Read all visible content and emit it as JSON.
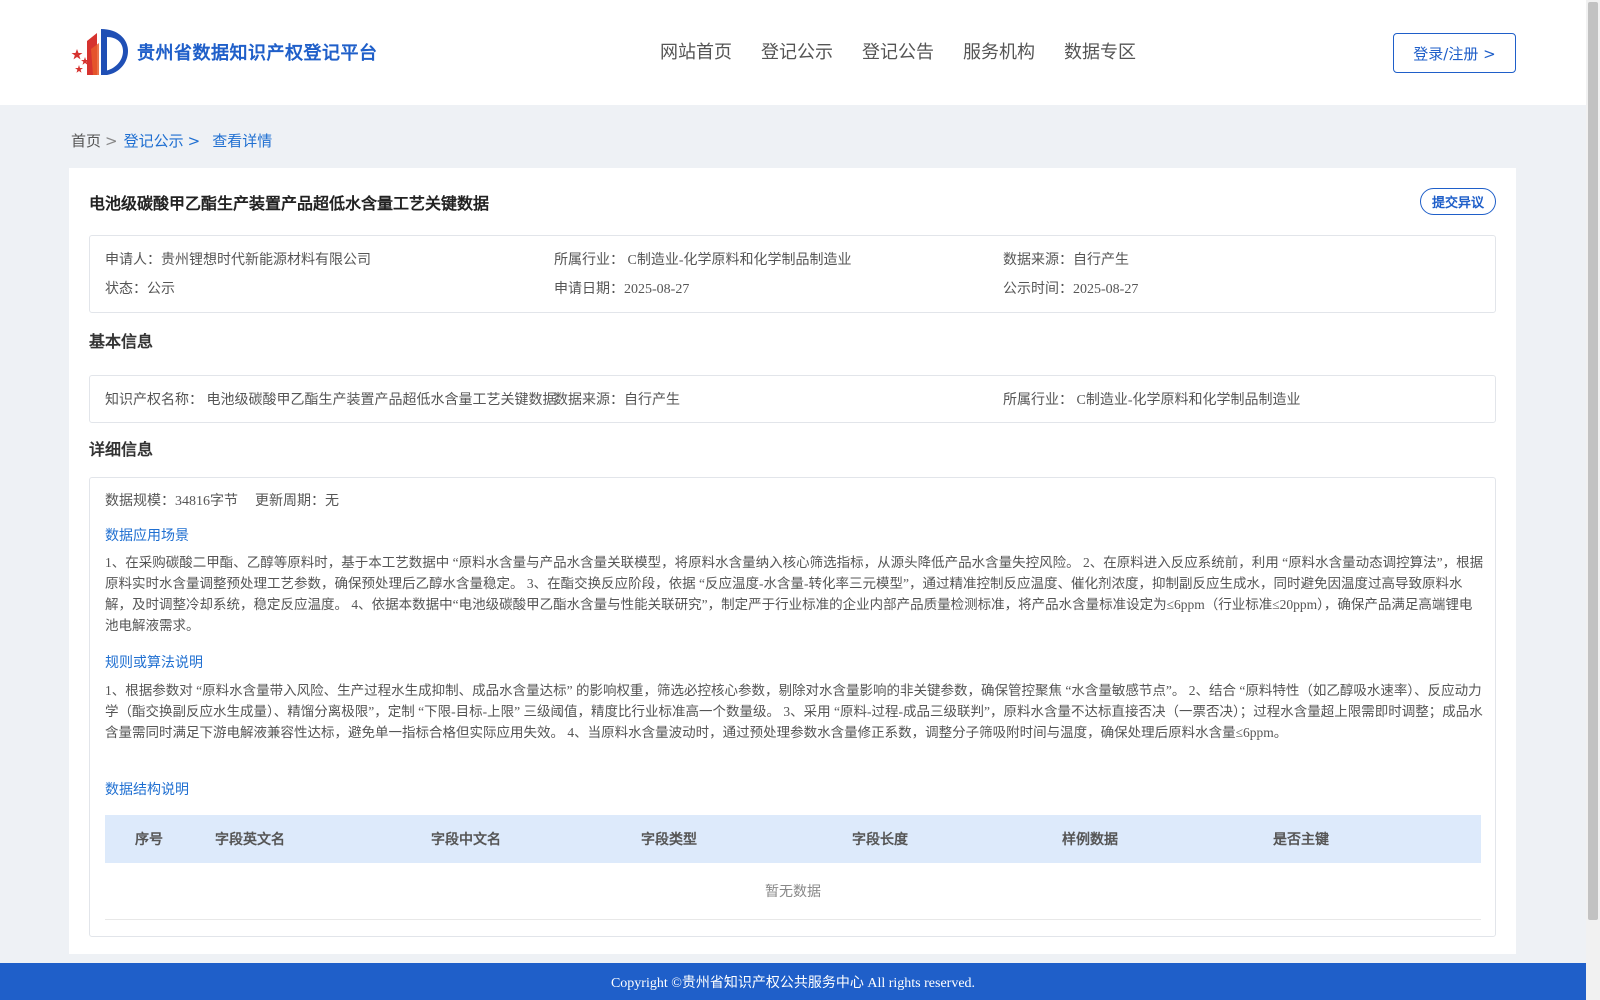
{
  "header": {
    "logo_text": "贵州省数据知识产权登记平台",
    "nav": [
      "网站首页",
      "登记公示",
      "登记公告",
      "服务机构",
      "数据专区"
    ],
    "login_label": "登录/注册 >"
  },
  "breadcrumb": {
    "home": "首页",
    "sep": ">",
    "level1": "登记公示",
    "current": "查看详情"
  },
  "record": {
    "title": "电池级碳酸甲乙酯生产装置产品超低水含量工艺关键数据",
    "objection_label": "提交异议",
    "summary": {
      "applicant": "申请人：贵州锂想时代新能源材料有限公司",
      "industry": "所属行业： C制造业-化学原料和化学制品制造业",
      "source": "数据来源：自行产生",
      "status": "状态：公示",
      "apply_date": "申请日期：2025-08-27",
      "publish_date": "公示时间：2025-08-27"
    }
  },
  "basic": {
    "heading": "基本信息",
    "ip_name": "知识产权名称： 电池级碳酸甲乙酯生产装置产品超低水含量工艺关键数据",
    "source": "数据来源：自行产生",
    "industry": "所属行业： C制造业-化学原料和化学制品制造业"
  },
  "detail": {
    "heading": "详细信息",
    "scale": "数据规模：34816字节",
    "cycle": "更新周期：无",
    "scenario_title": "数据应用场景",
    "scenario_text": "1、在采购碳酸二甲酯、乙醇等原料时，基于本工艺数据中 “原料水含量与产品水含量关联模型，将原料水含量纳入核心筛选指标，从源头降低产品水含量失控风险。 2、在原料进入反应系统前，利用 “原料水含量动态调控算法”，根据原料实时水含量调整预处理工艺参数，确保预处理后乙醇水含量稳定。 3、在酯交换反应阶段，依据 “反应温度-水含量-转化率三元模型”，通过精准控制反应温度、催化剂浓度，抑制副反应生成水，同时避免因温度过高导致原料水解，及时调整冷却系统，稳定反应温度。 4、依据本数据中“电池级碳酸甲乙酯水含量与性能关联研究”，制定严于行业标准的企业内部产品质量检测标准，将产品水含量标准设定为≤6ppm（行业标准≤20ppm），确保产品满足高端锂电池电解液需求。",
    "rule_title": "规则或算法说明",
    "rule_text": "1、根据参数对 “原料水含量带入风险、生产过程水生成抑制、成品水含量达标” 的影响权重，筛选必控核心参数，剔除对水含量影响的非关键参数，确保管控聚焦 “水含量敏感节点”。 2、结合 “原料特性（如乙醇吸水速率）、反应动力学（酯交换副反应水生成量）、精馏分离极限”，定制 “下限-目标-上限” 三级阈值，精度比行业标准高一个数量级。 3、采用 “原料-过程-成品三级联判”，原料水含量不达标直接否决（一票否决）；过程水含量超上限需即时调整；成品水含量需同时满足下游电解液兼容性达标，避免单一指标合格但实际应用失效。 4、当原料水含量波动时，通过预处理参数水含量修正系数，调整分子筛吸附时间与温度，确保处理后原料水含量≤6ppm。",
    "structure_title": "数据结构说明",
    "table_headers": [
      "序号",
      "字段英文名",
      "字段中文名",
      "字段类型",
      "字段长度",
      "样例数据",
      "是否主键"
    ],
    "empty_text": "暂无数据"
  },
  "footer": {
    "copyright": "Copyright ©贵州省知识产权公共服务中心 All rights reserved."
  },
  "colors": {
    "brand": "#1f5fc9",
    "link": "#1f6fd1",
    "table_head_bg": "#ddeafb"
  }
}
